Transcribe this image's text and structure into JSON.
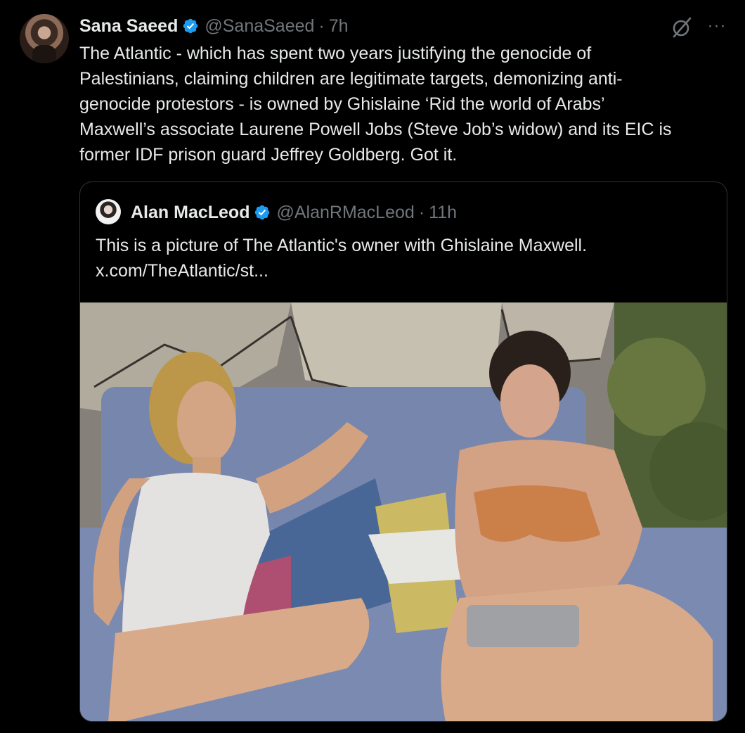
{
  "tweet": {
    "author": {
      "display_name": "Sana Saeed",
      "handle": "@SanaSaeed",
      "verified": true
    },
    "time": "7h",
    "text": "The Atlantic - which has spent two years justifying the genocide of\nPalestinians, claiming children are legitimate targets, demonizing anti-\ngenocide protestors - is owned by Ghislaine ‘Rid the world of Arabs’\nMaxwell’s associate Laurene Powell Jobs (Steve Job’s widow) and its EIC is\nformer IDF prison guard Jeffrey Goldberg. Got it.",
    "actions": {
      "grok_icon": "grok-icon",
      "more_label": "···"
    }
  },
  "quote": {
    "author": {
      "display_name": "Alan MacLeod",
      "handle": "@AlanRMacLeod",
      "verified": true
    },
    "time": "11h",
    "text": "This is a picture of The Atlantic's owner with Ghislaine Maxwell.\nx.com/TheAtlantic/st...",
    "media": {
      "type": "photo"
    }
  },
  "colors": {
    "background": "#000000",
    "text": "#e7e9ea",
    "muted": "#71767b",
    "verified_blue": "#1d9bf0",
    "border": "#2f3336"
  }
}
